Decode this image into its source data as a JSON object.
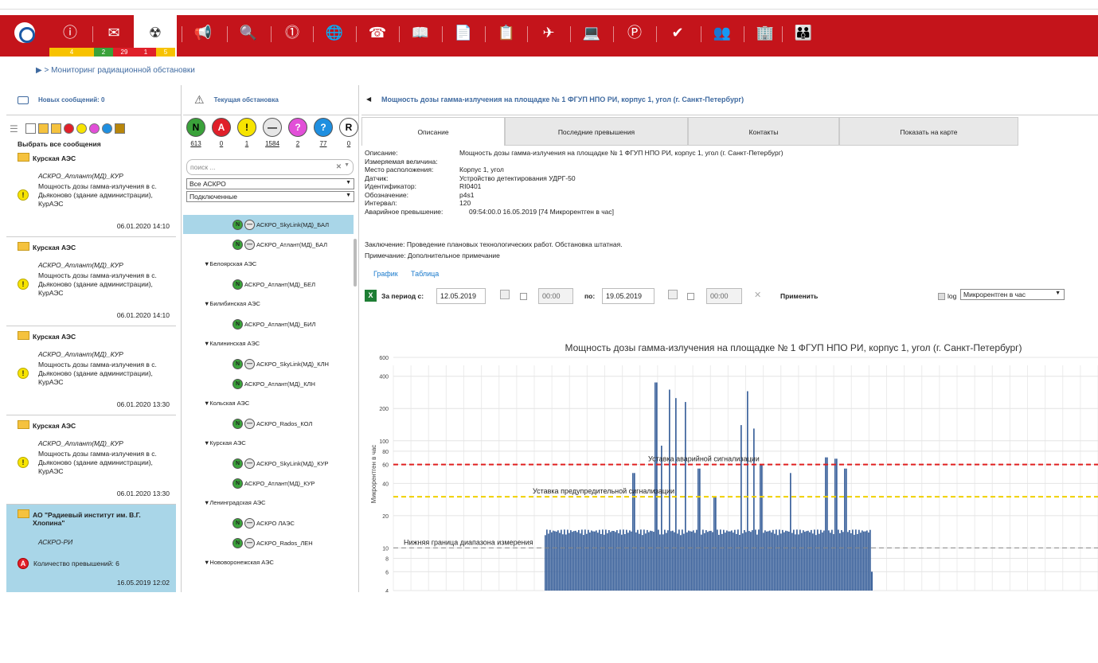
{
  "toolbar": {
    "counters": [
      "4",
      "2",
      "29",
      "1",
      "5"
    ],
    "colors": {
      "bar": "#c4141b",
      "yellow": "#f7c200",
      "green": "#3aa23a",
      "red": "#e0202a"
    }
  },
  "breadcrumb": "▶ > Мониторинг радиационной обстановки",
  "messages_panel": {
    "header": "Новых сообщений: 0",
    "select_all": "Выбрать все сообщения",
    "items": [
      {
        "org": "Курская АЭС",
        "system": "АСКРО_Атлант(МД)_КУР",
        "text": "Мощность дозы гамма-излучения в с. Дьяконово (здание администрации), КурАЭС",
        "date": "06.01.2020 14:10"
      },
      {
        "org": "Курская АЭС",
        "system": "АСКРО_Атлант(МД)_КУР",
        "text": "Мощность дозы гамма-излучения в с. Дьяконово (здание администрации), КурАЭС",
        "date": "06.01.2020 14:10"
      },
      {
        "org": "Курская АЭС",
        "system": "АСКРО_Атлант(МД)_КУР",
        "text": "Мощность дозы гамма-излучения в с. Дьяконово (здание администрации), КурАЭС",
        "date": "06.01.2020 13:30"
      },
      {
        "org": "Курская АЭС",
        "system": "АСКРО_Атлант(МД)_КУР",
        "text": "Мощность дозы гамма-излучения в с. Дьяконово (здание администрации), КурАЭС",
        "date": "06.01.2020 13:30"
      },
      {
        "org": "АО \"Радиевый институт им. В.Г. Хлопина\"",
        "system": "АСКРО-РИ",
        "text": "Количество превышений: 6",
        "date": "16.05.2019 12:02"
      }
    ]
  },
  "situation_panel": {
    "header": "Текущая обстановка",
    "status_counts": [
      {
        "letter": "N",
        "count": "613",
        "color": "#3aa23a"
      },
      {
        "letter": "A",
        "count": "0",
        "color": "#e0202a"
      },
      {
        "letter": "!",
        "count": "1",
        "color": "#f7e400"
      },
      {
        "letter": "—",
        "count": "1584",
        "color": "#e6e6e6"
      },
      {
        "letter": "?",
        "count": "2",
        "color": "#e24fd8"
      },
      {
        "letter": "?",
        "count": "77",
        "color": "#1f8fe0"
      },
      {
        "letter": "R",
        "count": "0",
        "color": "#ffffff"
      }
    ],
    "search_placeholder": "поиск ...",
    "filter1": "Все АСКРО",
    "filter2": "Подключенные",
    "tree": [
      {
        "type": "node",
        "label": "АСКРО_SkyLink(МД)_БАЛ",
        "sel": true
      },
      {
        "type": "node",
        "label": "АСКРО_Атлант(МД)_БАЛ"
      },
      {
        "type": "group",
        "label": "▼Белоярская АЭС"
      },
      {
        "type": "node",
        "label": "АСКРО_Атлант(МД)_БЕЛ"
      },
      {
        "type": "group",
        "label": "▼Билибинская АЭС"
      },
      {
        "type": "node",
        "label": "АСКРО_Атлант(МД)_БИЛ"
      },
      {
        "type": "group",
        "label": "▼Калининская АЭС"
      },
      {
        "type": "node",
        "label": "АСКРО_SkyLink(МД)_КЛН"
      },
      {
        "type": "node",
        "label": "АСКРО_Атлант(МД)_КЛН"
      },
      {
        "type": "group",
        "label": "▼Кольская АЭС"
      },
      {
        "type": "node",
        "label": "АСКРО_Rados_КОЛ"
      },
      {
        "type": "group",
        "label": "▼Курская АЭС"
      },
      {
        "type": "node",
        "label": "АСКРО_SkyLink(МД)_КУР"
      },
      {
        "type": "node",
        "label": "АСКРО_Атлант(МД)_КУР"
      },
      {
        "type": "group",
        "label": "▼Ленинградская АЭС"
      },
      {
        "type": "node",
        "label": "АСКРО ЛАЭС"
      },
      {
        "type": "node",
        "label": "АСКРО_Rados_ЛЕН"
      },
      {
        "type": "group",
        "label": "▼Нововоронежская АЭС"
      }
    ]
  },
  "detail": {
    "title": "Мощность дозы гамма-излучения на площадке № 1 ФГУП НПО РИ, корпус 1, угол (г. Санкт-Петербург)",
    "tabs": [
      "Описание",
      "Последние превышения",
      "Контакты",
      "Показать на карте"
    ],
    "fields": [
      {
        "label": "Описание:",
        "value": "Мощность дозы гамма-излучения на площадке № 1 ФГУП НПО РИ, корпус 1, угол (г. Санкт-Петербург)"
      },
      {
        "label": "Измеряемая величина:",
        "value": ""
      },
      {
        "label": "Место расположения:",
        "value": "Корпус 1, угол"
      },
      {
        "label": "Датчик:",
        "value": "Устройство детектирования УДРГ-50"
      },
      {
        "label": "Идентификатор:",
        "value": "RI0401"
      },
      {
        "label": "Обозначение:",
        "value": "p4s1"
      },
      {
        "label": "Интервал:",
        "value": "120"
      },
      {
        "label": "Аварийное превышение:",
        "value": "09:54:00.0 16.05.2019 [74 Микрорентген в час]"
      }
    ],
    "conclusion": "Заключение:  Проведение плановых технологических работ. Обстановка штатная.",
    "note": "Примечание:  Дополнительное примечание",
    "view_links": [
      "График",
      "Таблица"
    ],
    "period_label": "За период с:",
    "date_from": "12.05.2019",
    "time_from": "00:00",
    "to_label": "по:",
    "date_to": "19.05.2019",
    "time_to": "00:00",
    "apply": "Применить",
    "log_label": "log",
    "unit_select": "Микрорентген в час"
  },
  "chart_data": {
    "type": "bar",
    "title": "Мощность дозы гамма-излучения на площадке № 1 ФГУП НПО РИ, корпус 1, угол (г. Санкт-Петербург)",
    "ylabel": "Микрорентген в час",
    "yscale": "log",
    "ylim": [
      4,
      600
    ],
    "yticks": [
      4,
      6,
      8,
      10,
      20,
      40,
      60,
      80,
      100,
      200,
      400,
      600
    ],
    "thresholds": [
      {
        "label": "Уставка аварийной сигнализации",
        "value": 60,
        "color": "#e02020"
      },
      {
        "label": "Уставка предупредительной сигнализации",
        "value": 30,
        "color": "#f0d000"
      },
      {
        "label": "Нижняя граница диапазона измерения",
        "value": 10,
        "color": "#888888"
      }
    ],
    "series": [
      {
        "base": 14,
        "spikes": [
          {
            "pos": 0.27,
            "value": 50
          },
          {
            "pos": 0.34,
            "value": 350
          },
          {
            "pos": 0.355,
            "value": 90
          },
          {
            "pos": 0.38,
            "value": 300
          },
          {
            "pos": 0.4,
            "value": 250
          },
          {
            "pos": 0.43,
            "value": 230
          },
          {
            "pos": 0.47,
            "value": 55
          },
          {
            "pos": 0.52,
            "value": 30
          },
          {
            "pos": 0.6,
            "value": 140
          },
          {
            "pos": 0.62,
            "value": 290
          },
          {
            "pos": 0.64,
            "value": 130
          },
          {
            "pos": 0.66,
            "value": 60
          },
          {
            "pos": 0.75,
            "value": 50
          },
          {
            "pos": 0.86,
            "value": 70
          },
          {
            "pos": 0.89,
            "value": 68
          },
          {
            "pos": 0.92,
            "value": 55
          }
        ]
      }
    ]
  }
}
